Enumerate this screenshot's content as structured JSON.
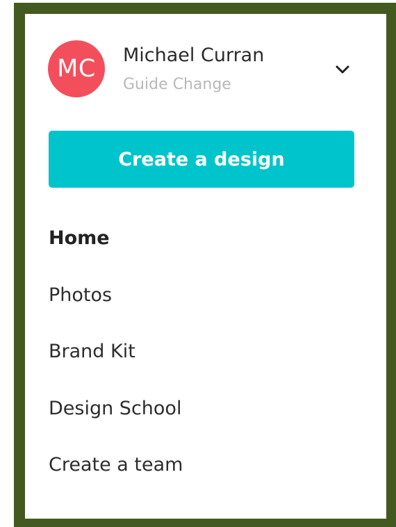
{
  "account": {
    "initials": "MC",
    "name": "Michael Curran",
    "subtitle": "Guide Change",
    "avatar_color": "#f34e5c",
    "menu_icon": "chevron-down-icon"
  },
  "primary_action": {
    "label": "Create a design",
    "color": "#00c4cc"
  },
  "nav": {
    "items": [
      {
        "label": "Home",
        "active": true
      },
      {
        "label": "Photos",
        "active": false
      },
      {
        "label": "Brand Kit",
        "active": false
      },
      {
        "label": "Design School",
        "active": false
      },
      {
        "label": "Create a team",
        "active": false
      }
    ]
  },
  "colors": {
    "frame_border": "#43591f",
    "panel_background": "#ffffff"
  }
}
